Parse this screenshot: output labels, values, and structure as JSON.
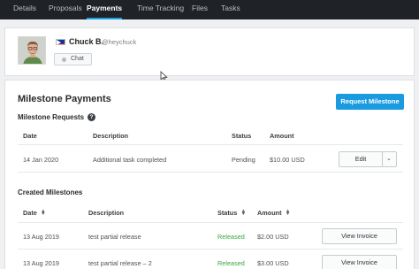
{
  "nav": {
    "tabs": [
      {
        "label": "Details"
      },
      {
        "label": "Proposals"
      },
      {
        "label": "Payments"
      },
      {
        "label": "Time Tracking"
      },
      {
        "label": "Files"
      },
      {
        "label": "Tasks"
      }
    ],
    "active_tab": "Payments",
    "active_color": "#1ba1e2"
  },
  "profile": {
    "name": "Chuck B.",
    "handle": "@heychuck",
    "chat_label": "Chat",
    "flag": "philippines-flag-icon"
  },
  "milestone_payments": {
    "title": "Milestone Payments",
    "request_button": "Request Milestone",
    "button_color": "#1a9be0",
    "requests": {
      "title": "Milestone Requests",
      "help_glyph": "?",
      "columns": [
        "Date",
        "Description",
        "Status",
        "Amount"
      ],
      "rows": [
        {
          "date": "14 Jan 2020",
          "description": "Additional task completed",
          "status": "Pending",
          "amount": "$10.00 USD",
          "action": "Edit"
        }
      ]
    },
    "created": {
      "title": "Created Milestones",
      "columns": [
        "Date",
        "Description",
        "Status",
        "Amount"
      ],
      "rows": [
        {
          "date": "13 Aug 2019",
          "description": "test partial release",
          "status": "Released",
          "amount": "$2.00 USD",
          "action": "View Invoice"
        },
        {
          "date": "13 Aug 2019",
          "description": "test partial release – 2",
          "status": "Released",
          "amount": "$3.00 USD",
          "action": "View Invoice"
        }
      ],
      "status_color": "#3da53d"
    }
  }
}
